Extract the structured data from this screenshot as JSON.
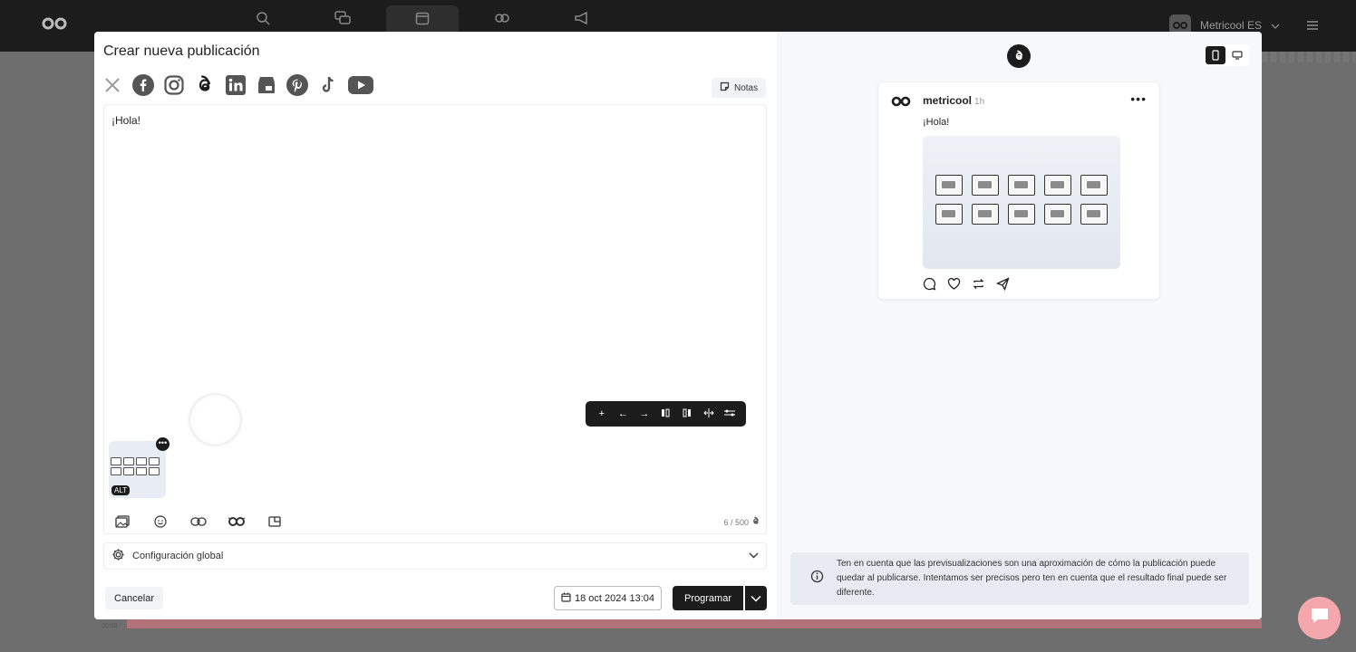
{
  "app": {
    "account_name": "Metricool ES"
  },
  "modal": {
    "title": "Crear nueva publicación",
    "notes_label": "Notas",
    "networks": [
      "x-icon",
      "facebook-icon",
      "instagram-icon",
      "threads-icon",
      "linkedin-icon",
      "google-business-icon",
      "pinterest-icon",
      "tiktok-icon",
      "youtube-icon"
    ],
    "editor_text": "¡Hola!",
    "media_alt_label": "ALT",
    "media_more": "•••",
    "char_counter": "6 / 500",
    "global_config_label": "Configuración global",
    "cancel_label": "Cancelar",
    "date_label": "18 oct 2024 13:04",
    "program_label": "Programar"
  },
  "preview": {
    "account": "metricool",
    "time": "1h",
    "more": "•••",
    "text": "¡Hola!",
    "notice": "Ten en cuenta que las previsualizaciones son una aproximación de cómo la publicación puede quedar al publicarse. Intentamos ser precisos pero ten en cuenta que el resultado final puede ser diferente."
  },
  "background": {
    "time_label": "20:00"
  },
  "colors": {
    "dark": "#1c1c1c",
    "accent_pink": "#f4a8ae",
    "calendar_bar": "#b2727a"
  }
}
